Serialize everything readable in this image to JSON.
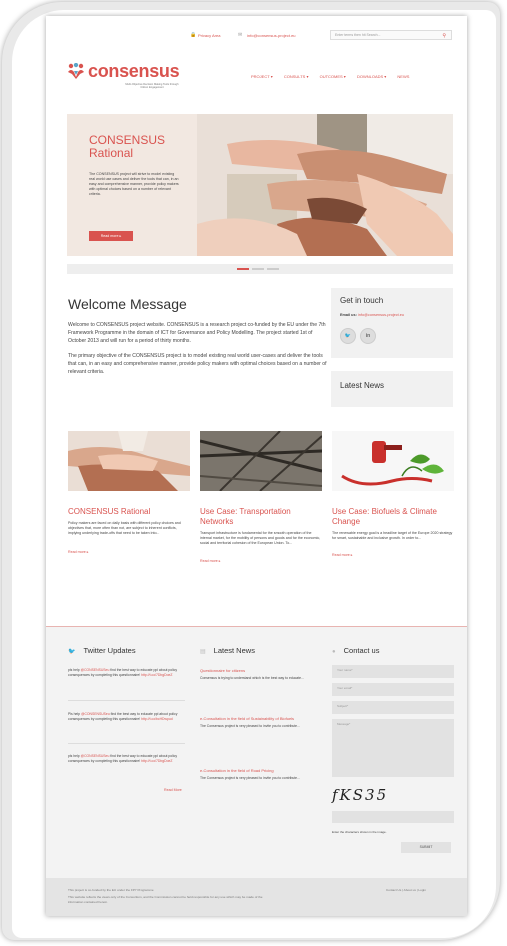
{
  "topbar": {
    "privacy": "Privacy Area",
    "email": "info@consensus-project.eu",
    "search_placeholder": "Enter terms then hit Search..."
  },
  "logo": {
    "name": "consensus",
    "tagline": "Multi-Objective Decision Making Tools through Citizen Engagement"
  },
  "nav": [
    "PROJECT ▾",
    "CONSULTS ▾",
    "OUTCOMES ▾",
    "DOWNLOADS ▾",
    "NEWS"
  ],
  "slider": {
    "title_line1": "CONSENSUS",
    "title_line2": "Rational",
    "text": "The CONSENSUS project will strive to model existing real world use cases and deliver the tools that can, in an easy and comprehensive manner, provide policy makers with optimal choices based on a number of relevant criteria.",
    "button": "Read more ▸"
  },
  "welcome": {
    "title": "Welcome Message",
    "p1": "Welcome to CONSENSUS project website. CONSENSUS is a research project co-funded by the EU under the 7th Framework Programme in the domain of ICT for Governance and Policy Modelling. The project started 1st of October 2013 and will run for a period of thirty months.",
    "p2": "The primary objective of the CONSENSUS project is to model existing real world user-cases and deliver the tools that can, in an easy and comprehensive manner, provide policy makers with optimal choices based on a number of relevant criteria."
  },
  "get_in_touch": {
    "title": "Get in touch",
    "email_label": "Email us:",
    "email": "info@consensus-project.eu",
    "social": [
      "🐦",
      "in"
    ]
  },
  "latest_news_box": {
    "title": "Latest News"
  },
  "cards": [
    {
      "title": "CONSENSUS Rational",
      "text": "Policy makers are faced on daily basis with different policy choices and objectives that, more often than not, are subject to inherent conflicts, implying underlying trade-offs that need to be taken into...",
      "more": "Read more ▸"
    },
    {
      "title": "Use Case: Transportation Networks",
      "text": "Transport infrastructure is fundamental for the smooth operation of the internal market, for the mobility of persons and goods and for the economic, social and territorial cohesion of the European Union. To...",
      "more": "Read more ▸"
    },
    {
      "title": "Use Case: Biofuels & Climate Change",
      "text": "The renewable energy goal is a headline target of the Europe 2020 strategy for smart, sustainable and inclusive growth. In order to...",
      "more": "Read more ▸"
    }
  ],
  "twitter": {
    "title": "Twitter Updates",
    "tweets": [
      {
        "pre": "pls help ",
        "handle": "@CONSENSUSeu",
        "body": " find the best way to educate ppl about policy consequences by completing this questionnaire! ",
        "link": "http://t.co/7DbgDoeZ"
      },
      {
        "pre": "Pls help ",
        "handle": "@CONSENSUSeu",
        "body": " find the best way to educate ppl about policy consequences by completing this questionnaire! ",
        "link": "http://t.co/bcHDwpud"
      },
      {
        "pre": "pls help ",
        "handle": "@CONSENSUSeu",
        "body": " find the best way to educate ppl about policy consequences by completing this questionnaire! ",
        "link": "http://t.co/7DbgDoeZ"
      }
    ],
    "read_more": "Read More"
  },
  "footer_news": {
    "title": "Latest News",
    "items": [
      {
        "title": "Questionnaire for citizens",
        "text": "Consensus is trying to understand which is the best way to educate..."
      },
      {
        "title": "e-Consultation in the field of Sustainability of Biofuels",
        "text": "The Consensus project is very pleased to invite you to contribute..."
      },
      {
        "title": "e-Consultation in the field of Road Pricing",
        "text": "The Consensus project is very pleased to invite you to contribute..."
      }
    ]
  },
  "contact": {
    "title": "Contact us",
    "fields": [
      "Your name*",
      "Your email*",
      "Subject*",
      "Message*"
    ],
    "captcha": "fKS35",
    "captcha_hint": "Enter the characters shown in the image.",
    "submit": "SUBMIT"
  },
  "bottom": {
    "line1": "This project is co-funded by the EU under the FP7 Programme",
    "line2": "This website reflects the views only of the Consortium, and the Commission cannot be held responsible for any use which may be made of the information contained herein.",
    "links": "Contact Us  |  About us  |  Login"
  },
  "colors": {
    "accent": "#d9534f"
  }
}
